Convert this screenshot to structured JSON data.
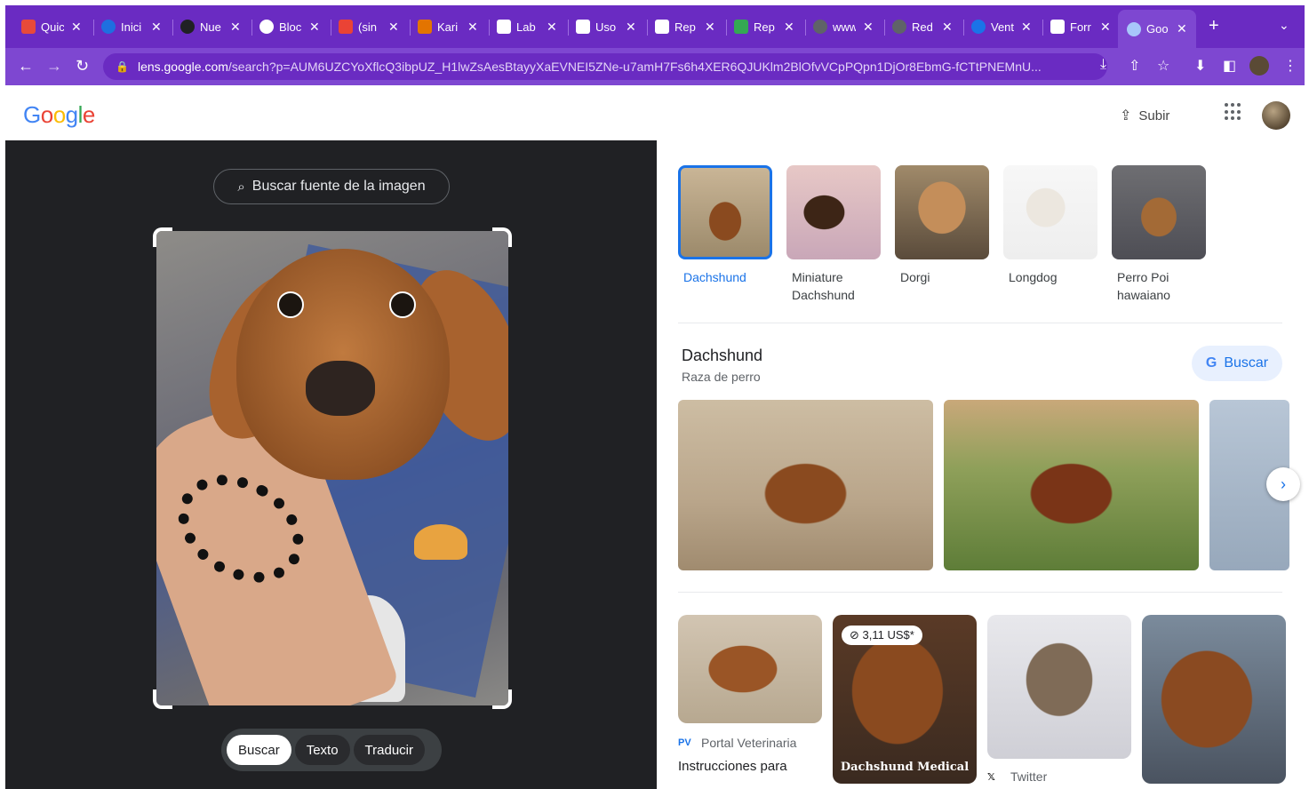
{
  "browser": {
    "tabs": [
      {
        "label": "Quic",
        "color": "#e84a3a"
      },
      {
        "label": "Inici",
        "color": "#1e6fe0"
      },
      {
        "label": "Nue",
        "color": "#202124"
      },
      {
        "label": "Bloc",
        "color": "#ffffff"
      },
      {
        "label": "(sin",
        "color": "#ea4335"
      },
      {
        "label": "Kari",
        "color": "#e37400"
      },
      {
        "label": "Lab",
        "color": "#ffffff"
      },
      {
        "label": "Uso",
        "color": "#ffffff"
      },
      {
        "label": "Rep",
        "color": "#ffffff"
      },
      {
        "label": "Rep",
        "color": "#34a853"
      },
      {
        "label": "www",
        "color": "#5f6368"
      },
      {
        "label": "Red",
        "color": "#5f6368"
      },
      {
        "label": "Vent",
        "color": "#1a73e8"
      },
      {
        "label": "Forr",
        "color": "#ffffff"
      }
    ],
    "active_tab": {
      "label": "Goo",
      "color": "#a8c7fa"
    },
    "url_host": "lens.google.com",
    "url_path": "/search?p=AUM6UZCYoXflcQ3ibpUZ_H1lwZsAesBtayyXaEVNEI5ZNe-u7amH7Fs6h4XER6QJUKlm2BlOfvVCpPQpn1DjOr8EbmG-fCTtPNEMnU..."
  },
  "header": {
    "logo": [
      "G",
      "o",
      "o",
      "g",
      "l",
      "e"
    ],
    "upload_label": "Subir"
  },
  "left": {
    "find_source": "Buscar fuente de la imagen",
    "modes": [
      "Buscar",
      "Texto",
      "Traducir"
    ]
  },
  "right": {
    "chips": [
      {
        "label": "Dachshund"
      },
      {
        "label": "Miniature Dachshund"
      },
      {
        "label": "Dorgi"
      },
      {
        "label": "Longdog"
      },
      {
        "label": "Perro Poi hawaiano"
      }
    ],
    "kp": {
      "title": "Dachshund",
      "subtitle": "Raza de perro",
      "search_button": "Buscar"
    },
    "results": [
      {
        "source": "Portal Veterinaria",
        "desc": "Instrucciones para"
      },
      {
        "price": "3,11 US$*",
        "overlay": "Dachshund Medical"
      },
      {
        "source": "Twitter"
      },
      {}
    ]
  },
  "colors": {
    "tabstrip": "#6a2bc2",
    "toolbar": "#7e47d1",
    "accent_blue": "#1a73e8",
    "dark_panel": "#202124"
  }
}
